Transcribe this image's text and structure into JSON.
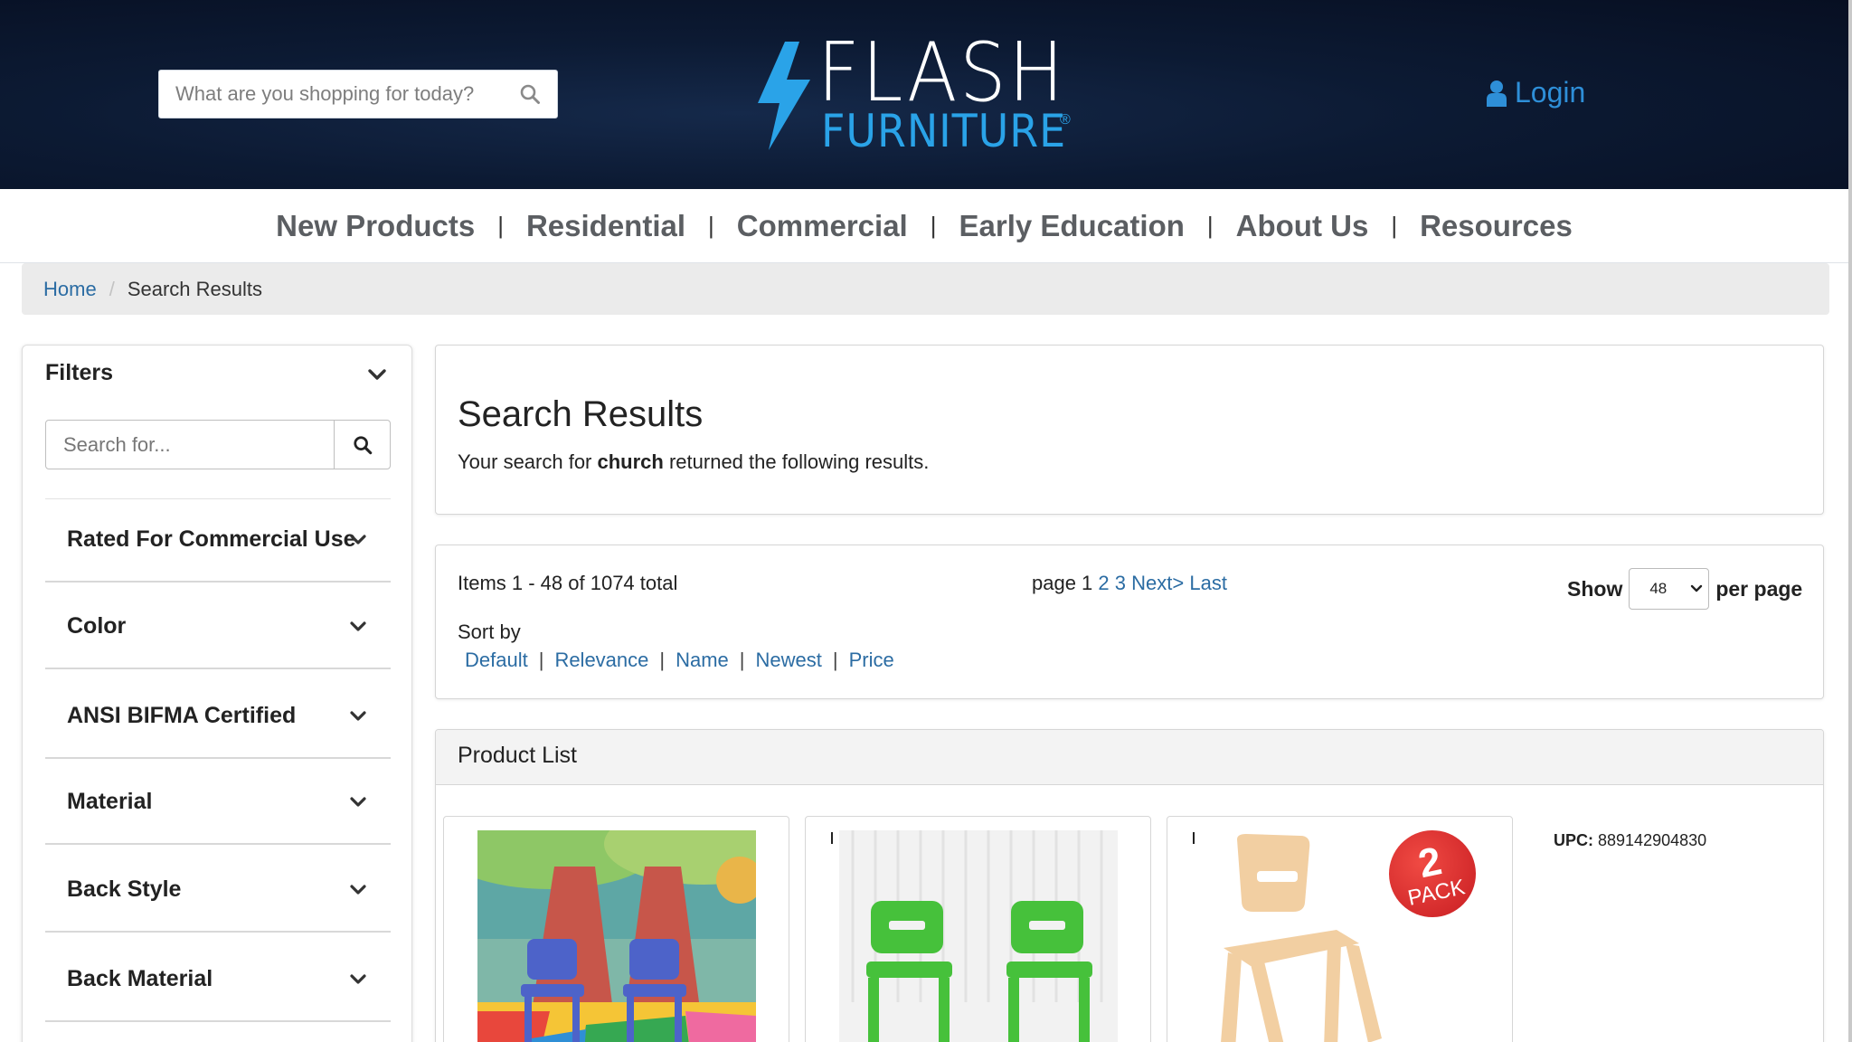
{
  "header": {
    "search_placeholder": "What are you shopping for today?",
    "logo_line1": "FLASH",
    "logo_line2": "FURNITURE",
    "logo_reg": "®",
    "login_label": "Login"
  },
  "nav": {
    "items": [
      "New Products",
      "Residential",
      "Commercial",
      "Early Education",
      "About Us",
      "Resources"
    ],
    "separator": "|"
  },
  "breadcrumb": {
    "home": "Home",
    "current": "Search Results"
  },
  "sidebar": {
    "title": "Filters",
    "search_placeholder": "Search for...",
    "facets": [
      "Rated For Commercial Use",
      "Color",
      "ANSI BIFMA Certified",
      "Material",
      "Back Style",
      "Back Material"
    ]
  },
  "results": {
    "heading": "Search Results",
    "desc_prefix": "Your search for ",
    "query": "church",
    "desc_suffix": " returned the following results."
  },
  "pager": {
    "items_text": "Items 1 - 48 of 1074 total",
    "page_label": "page 1",
    "page_links": [
      "2",
      "3",
      "Next>",
      "Last"
    ],
    "show_label": "Show",
    "per_page_value": "48",
    "per_page_label": "per page",
    "sort_label": "Sort by",
    "sort_options": [
      "Default",
      "Relevance",
      "Name",
      "Newest",
      "Price"
    ]
  },
  "product_list": {
    "heading": "Product List",
    "upc_label": "UPC:",
    "upc_value": "889142904830",
    "badge_number": "2",
    "badge_text": "PACK"
  },
  "colors": {
    "header_bg": "#0c1a33",
    "accent_blue": "#2aa3e8",
    "link_blue": "#2b6ca3",
    "nav_text": "#5b5e62"
  }
}
